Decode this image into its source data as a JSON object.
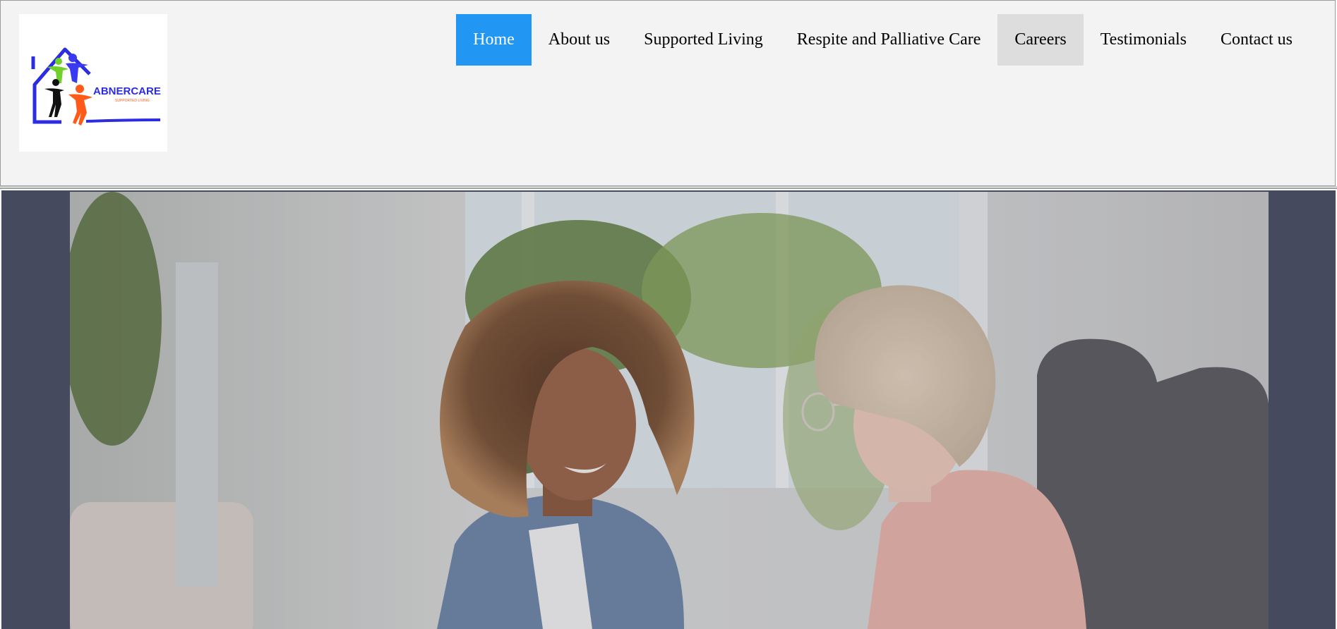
{
  "logo": {
    "brand_text": "ABNERCARE",
    "tagline_text": "SUPPORTED LIVING",
    "colors": {
      "house": "#2c2ce0",
      "figure_green": "#6fd12a",
      "figure_blue": "#3a3af0",
      "figure_black": "#111111",
      "figure_orange": "#ff5a1a"
    }
  },
  "nav": {
    "items": [
      {
        "label": "Home",
        "state": "active"
      },
      {
        "label": "About us",
        "state": ""
      },
      {
        "label": "Supported Living",
        "state": ""
      },
      {
        "label": "Respite and Palliative Care",
        "state": ""
      },
      {
        "label": "Careers",
        "state": "hover"
      },
      {
        "label": "Testimonials",
        "state": ""
      },
      {
        "label": "Contact us",
        "state": ""
      }
    ]
  },
  "colors": {
    "header_bg": "#f3f3f3",
    "active_nav_bg": "#2196f3",
    "hover_nav_bg": "#dddddd",
    "hero_bg": "#454a5e"
  },
  "hero": {
    "image_description_name": "caregiver-and-elderly-woman-photo"
  }
}
